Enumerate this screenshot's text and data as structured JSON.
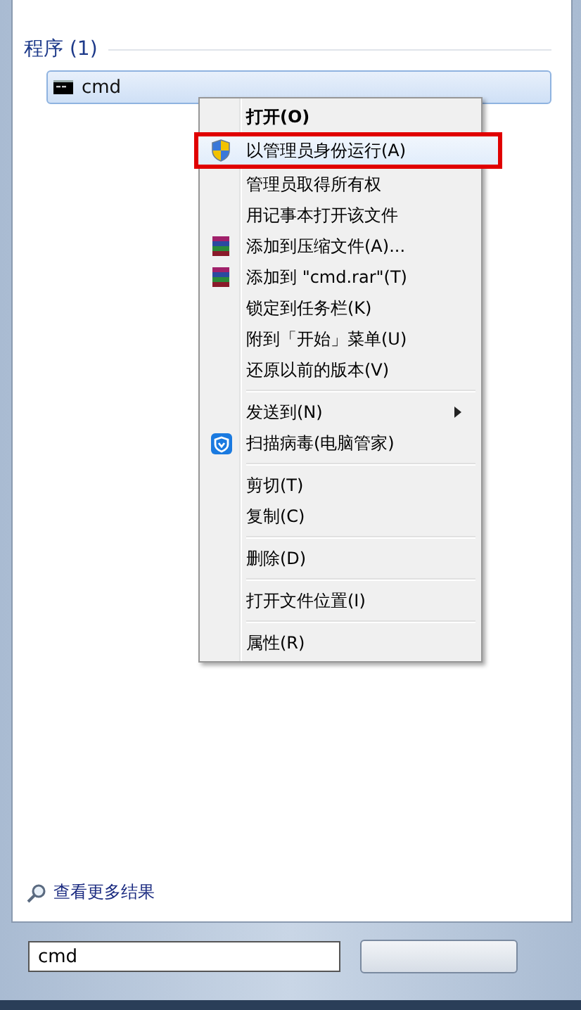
{
  "results": {
    "heading": "程序 (1)",
    "items": [
      {
        "label": "cmd",
        "selected": true
      }
    ]
  },
  "context_menu": {
    "items": [
      {
        "kind": "plain",
        "label": "打开(O)",
        "bold": true,
        "highlighted": false,
        "has_submenu": false
      },
      {
        "kind": "shield",
        "label": "以管理员身份运行(A)",
        "bold": false,
        "highlighted": true,
        "has_submenu": false
      },
      {
        "kind": "plain",
        "label": "管理员取得所有权",
        "bold": false,
        "highlighted": false,
        "has_submenu": false
      },
      {
        "kind": "plain",
        "label": "用记事本打开该文件",
        "bold": false,
        "highlighted": false,
        "has_submenu": false
      },
      {
        "kind": "archive",
        "label": "添加到压缩文件(A)...",
        "bold": false,
        "highlighted": false,
        "has_submenu": false
      },
      {
        "kind": "archive",
        "label": "添加到 \"cmd.rar\"(T)",
        "bold": false,
        "highlighted": false,
        "has_submenu": false
      },
      {
        "kind": "plain",
        "label": "锁定到任务栏(K)",
        "bold": false,
        "highlighted": false,
        "has_submenu": false
      },
      {
        "kind": "plain",
        "label": "附到「开始」菜单(U)",
        "bold": false,
        "highlighted": false,
        "has_submenu": false
      },
      {
        "kind": "plain",
        "label": "还原以前的版本(V)",
        "bold": false,
        "highlighted": false,
        "has_submenu": false
      },
      {
        "kind": "separator"
      },
      {
        "kind": "plain",
        "label": "发送到(N)",
        "bold": false,
        "highlighted": false,
        "has_submenu": true
      },
      {
        "kind": "guard",
        "label": "扫描病毒(电脑管家)",
        "bold": false,
        "highlighted": false,
        "has_submenu": false
      },
      {
        "kind": "separator"
      },
      {
        "kind": "plain",
        "label": "剪切(T)",
        "bold": false,
        "highlighted": false,
        "has_submenu": false
      },
      {
        "kind": "plain",
        "label": "复制(C)",
        "bold": false,
        "highlighted": false,
        "has_submenu": false
      },
      {
        "kind": "separator"
      },
      {
        "kind": "plain",
        "label": "删除(D)",
        "bold": false,
        "highlighted": false,
        "has_submenu": false
      },
      {
        "kind": "separator"
      },
      {
        "kind": "plain",
        "label": "打开文件位置(I)",
        "bold": false,
        "highlighted": false,
        "has_submenu": false
      },
      {
        "kind": "separator"
      },
      {
        "kind": "plain",
        "label": "属性(R)",
        "bold": false,
        "highlighted": false,
        "has_submenu": false
      }
    ]
  },
  "more_results": "查看更多结果",
  "search": {
    "value": "cmd"
  }
}
